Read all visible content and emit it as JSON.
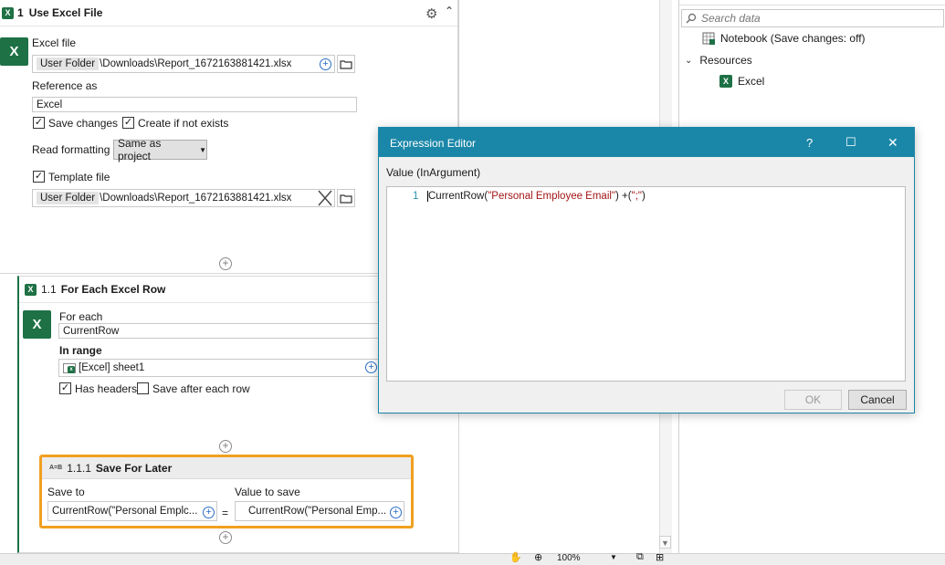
{
  "use_excel_file": {
    "number": "1",
    "title": "Use Excel File",
    "excel_file_label": "Excel file",
    "excel_file_chip": "User Folder",
    "excel_file_path": "\\Downloads\\Report_1672163881421.xlsx",
    "reference_as_label": "Reference as",
    "reference_as_value": "Excel",
    "save_changes_label": "Save changes",
    "save_changes_checked": true,
    "create_if_not_exists_label": "Create if not exists",
    "create_if_not_exists_checked": true,
    "read_formatting_label": "Read formatting",
    "read_formatting_value": "Same as project",
    "template_file_label": "Template file",
    "template_file_checked": true,
    "template_file_chip": "User Folder",
    "template_file_path": "\\Downloads\\Report_1672163881421.xlsx"
  },
  "for_each_row": {
    "number": "1.1",
    "title": "For Each Excel Row",
    "for_each_label": "For each",
    "for_each_value": "CurrentRow",
    "in_range_label": "In range",
    "in_range_value": "[Excel] sheet1",
    "has_headers_label": "Has headers",
    "has_headers_checked": true,
    "save_after_each_row_label": "Save after each row",
    "save_after_each_row_checked": false
  },
  "save_for_later": {
    "icon_text": "A=B",
    "number": "1.1.1",
    "title": "Save For Later",
    "save_to_label": "Save to",
    "save_to_value": "CurrentRow(\"Personal Emplc...",
    "equals": "=",
    "value_to_save_label": "Value to save",
    "value_to_save_value": "CurrentRow(\"Personal Emp..."
  },
  "right_panel": {
    "search_placeholder": "Search data",
    "notebook_label": "Notebook (Save changes: off)",
    "resources_label": "Resources",
    "excel_label": "Excel"
  },
  "expression_editor": {
    "title": "Expression Editor",
    "help": "?",
    "maximize": "☐",
    "close": "✕",
    "value_label": "Value (InArgument)",
    "line_number": "1",
    "code_prefix": "CurrentRow(",
    "code_string": "\"Personal Employee Email\"",
    "code_middle": ") +(",
    "code_string2": "\";\"",
    "code_suffix": ")",
    "ok_label": "OK",
    "cancel_label": "Cancel"
  },
  "statusbar": {
    "zoom": "100%"
  },
  "colors": {
    "dialog_titlebar": "#1b87a8",
    "excel_green": "#1e7145",
    "highlight_orange": "#f0a020",
    "string_red": "#a31515"
  }
}
